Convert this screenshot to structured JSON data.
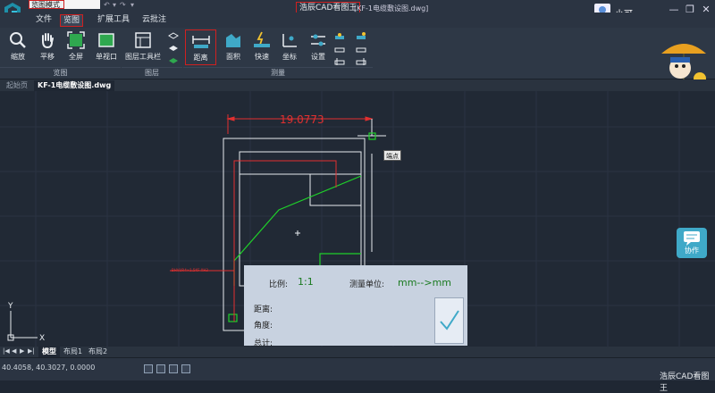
{
  "titlebar": {
    "mode": "览图模式",
    "app_title": "浩辰CAD看图王",
    "file_title": "[KF-1电缆敷设图.dwg]",
    "user_name": "小可...",
    "win_min": "—",
    "win_restore": "❐",
    "win_close": "✕"
  },
  "menu": {
    "items": [
      "文件",
      "览图",
      "扩展工具",
      "云批注"
    ],
    "active": "览图"
  },
  "ribbon": {
    "buttons": {
      "zoom": "缩放",
      "pan": "平移",
      "fullscreen": "全屏",
      "single_viewport": "单视口",
      "layer_toolbar": "图层工具栏",
      "distance": "距离",
      "area": "面积",
      "quick": "快速",
      "coordinate": "坐标",
      "settings": "设置"
    },
    "groups": {
      "view": "览图",
      "layer": "图层",
      "measure": "测量"
    }
  },
  "tabs": {
    "start": "起始页",
    "doc": "KF-1电缆敷设图.dwg"
  },
  "drawing": {
    "dimension": "19.0773",
    "snap_label": "端点",
    "red_note": "BHVUR4×1.5KF-XH3"
  },
  "measure_panel": {
    "scale_label": "比例:",
    "scale_value": "1:1",
    "unit_label": "测量单位:",
    "unit_value": "mm-->mm",
    "distance_label": "距离:",
    "angle_label": "角度:",
    "total_label": "总计:"
  },
  "collab": {
    "label": "协作"
  },
  "layout_tabs": {
    "nav": [
      "|◀",
      "◀",
      "▶",
      "▶|"
    ],
    "tabs": [
      "模型",
      "布局1",
      "布局2"
    ],
    "active": "模型"
  },
  "status": {
    "coords": "40.4058, 40.3027, 0.0000",
    "brand": "浩辰CAD看图王"
  },
  "colors": {
    "accent_red": "#d02020",
    "cad_green": "#1fd02a",
    "cad_red": "#e23030",
    "panel_bg": "#c8d2e0"
  }
}
